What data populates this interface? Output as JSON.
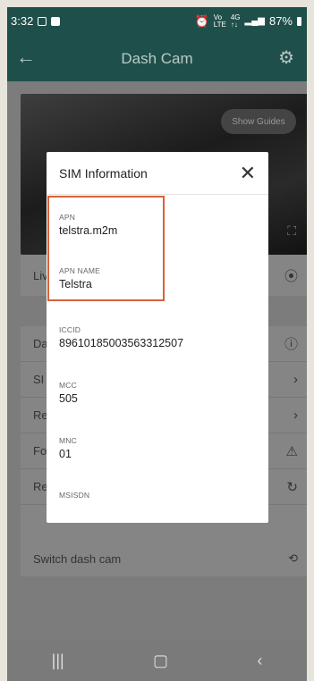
{
  "status": {
    "time": "3:32",
    "battery": "87%"
  },
  "appbar": {
    "title": "Dash Cam"
  },
  "video": {
    "guides_label": "Show Guides"
  },
  "rows": {
    "live": "Liv",
    "items": [
      "Da",
      "SI",
      "Re",
      "Fo",
      "Re"
    ],
    "switch": "Switch dash cam"
  },
  "dialog": {
    "title": "SIM Information",
    "fields": [
      {
        "label": "APN",
        "value": "telstra.m2m"
      },
      {
        "label": "APN NAME",
        "value": "Telstra"
      },
      {
        "label": "ICCID",
        "value": "89610185003563312507"
      },
      {
        "label": "MCC",
        "value": "505"
      },
      {
        "label": "MNC",
        "value": "01"
      },
      {
        "label": "MSISDN",
        "value": ""
      }
    ]
  },
  "colors": {
    "header": "#1f4f4a",
    "highlight": "#d9603a"
  }
}
